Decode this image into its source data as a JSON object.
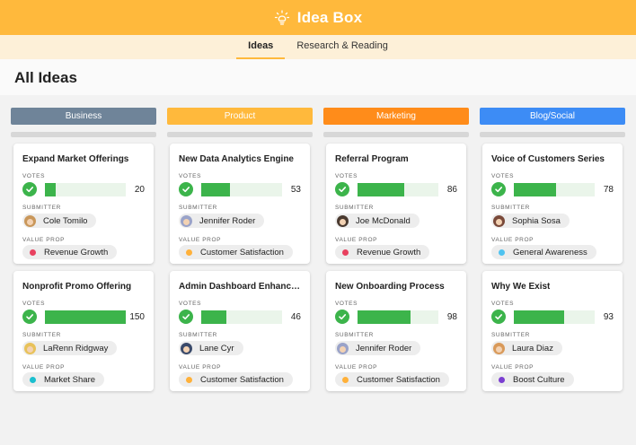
{
  "app": {
    "title": "Idea Box",
    "icon": "lightbulb-icon"
  },
  "tabs": [
    {
      "label": "Ideas",
      "active": true
    },
    {
      "label": "Research & Reading",
      "active": false
    }
  ],
  "page": {
    "title": "All Ideas"
  },
  "labels": {
    "votes": "VOTES",
    "submitter": "SUBMITTER",
    "value_prop": "VALUE PROP"
  },
  "max_votes": 150,
  "columns": [
    {
      "name": "Business",
      "color": "#6f8499",
      "text_color": "#ffffff",
      "cards": [
        {
          "title": "Expand Market Offerings",
          "votes": 20,
          "submitter": "Cole Tomilo",
          "avatar_color": "#c9975a",
          "value_prop": "Revenue Growth",
          "dot_color": "#e8415f"
        },
        {
          "title": "Nonprofit Promo Offering",
          "votes": 150,
          "submitter": "LaRenn Ridgway",
          "avatar_color": "#e8c25a",
          "value_prop": "Market Share",
          "dot_color": "#1bbfcf"
        }
      ]
    },
    {
      "name": "Product",
      "color": "#ffb93c",
      "text_color": "#ffffff",
      "cards": [
        {
          "title": "New Data Analytics Engine",
          "votes": 53,
          "submitter": "Jennifer Roder",
          "avatar_color": "#9aa3c9",
          "value_prop": "Customer Satisfaction",
          "dot_color": "#ffb13a"
        },
        {
          "title": "Admin Dashboard Enhancements",
          "votes": 46,
          "submitter": "Lane Cyr",
          "avatar_color": "#3a4a6a",
          "value_prop": "Customer Satisfaction",
          "dot_color": "#ffb13a"
        }
      ]
    },
    {
      "name": "Marketing",
      "color": "#ff8c1a",
      "text_color": "#ffffff",
      "cards": [
        {
          "title": "Referral Program",
          "votes": 86,
          "submitter": "Joe McDonald",
          "avatar_color": "#4a3a30",
          "value_prop": "Revenue Growth",
          "dot_color": "#e8415f"
        },
        {
          "title": "New Onboarding Process",
          "votes": 98,
          "submitter": "Jennifer Roder",
          "avatar_color": "#9aa3c9",
          "value_prop": "Customer Satisfaction",
          "dot_color": "#ffb13a"
        }
      ]
    },
    {
      "name": "Blog/Social",
      "color": "#3d8cf5",
      "text_color": "#ffffff",
      "cards": [
        {
          "title": "Voice of Customers Series",
          "votes": 78,
          "submitter": "Sophia Sosa",
          "avatar_color": "#7a4a3a",
          "value_prop": "General Awareness",
          "dot_color": "#4fc3f0"
        },
        {
          "title": "Why We Exist",
          "votes": 93,
          "submitter": "Laura Diaz",
          "avatar_color": "#d99a5a",
          "value_prop": "Boost Culture",
          "dot_color": "#7b3fd1"
        }
      ]
    }
  ]
}
